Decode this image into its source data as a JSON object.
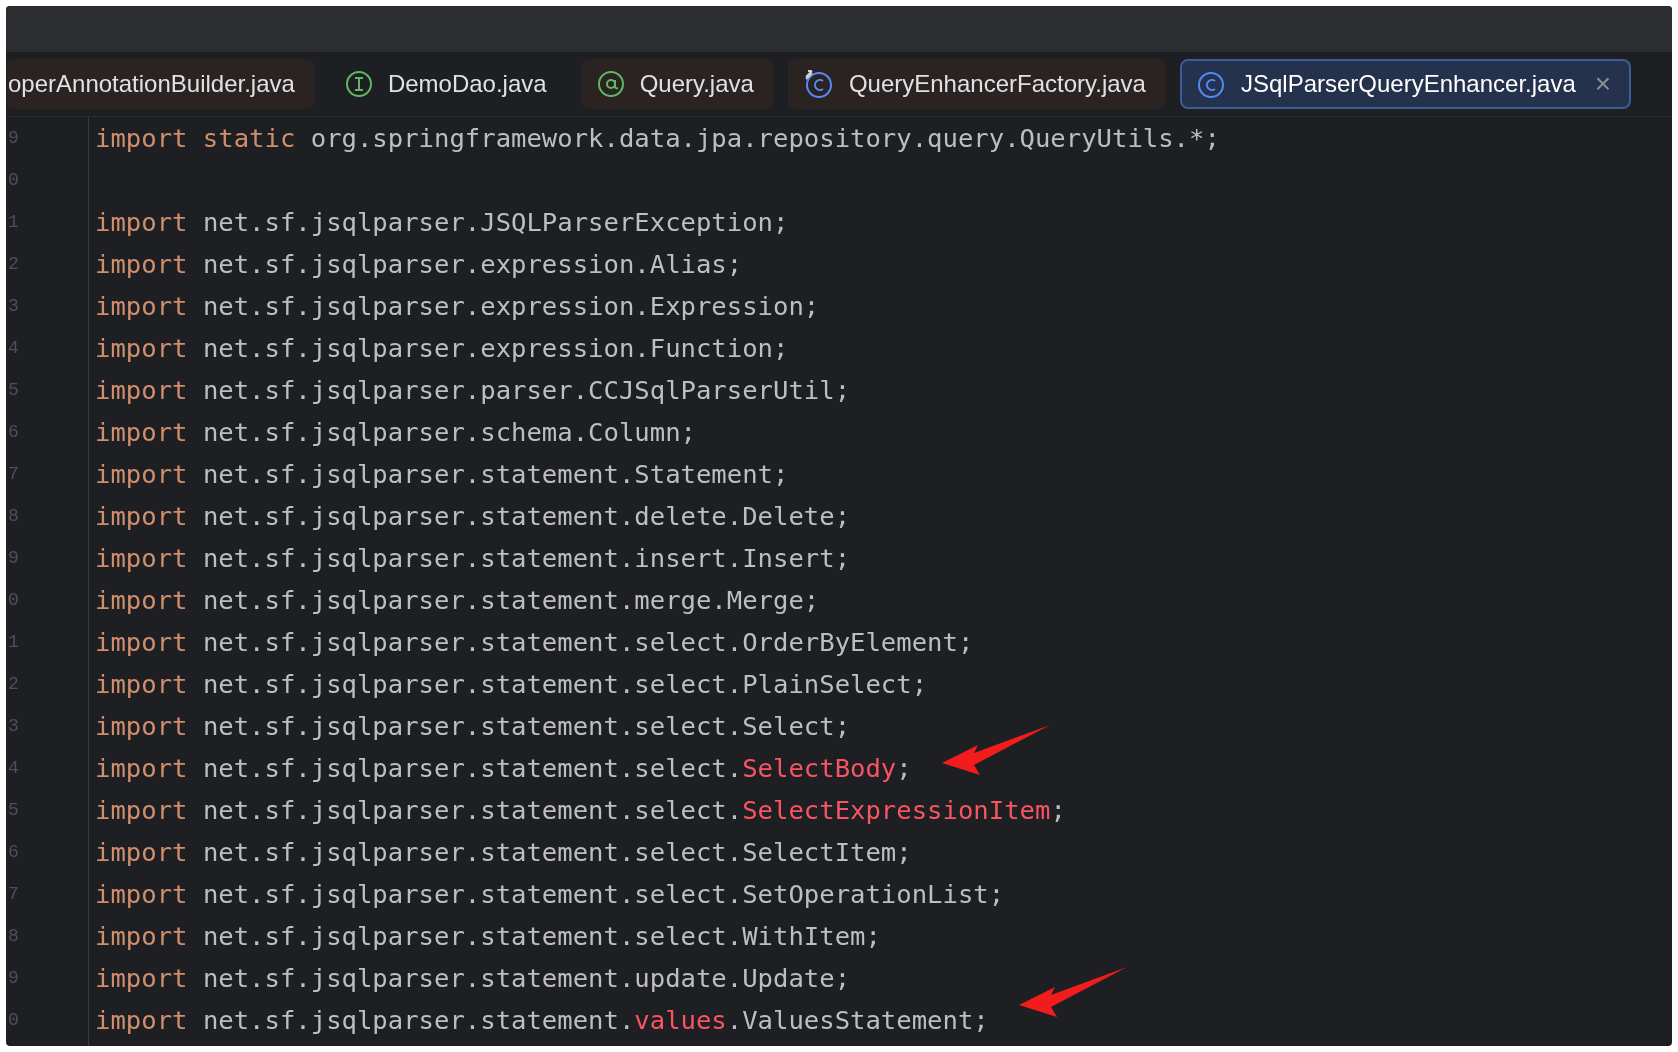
{
  "tabs": [
    {
      "label": "operAnnotationBuilder.java",
      "kind": "none",
      "selected": false,
      "color": "#2b2322"
    },
    {
      "label": "DemoDao.java",
      "kind": "interface",
      "selected": false
    },
    {
      "label": "Query.java",
      "kind": "annotation",
      "selected": false,
      "color": "#2b2322"
    },
    {
      "label": "QueryEnhancerFactory.java",
      "kind": "class-linked",
      "selected": false,
      "color": "#2b2322"
    },
    {
      "label": "JSqlParserQueryEnhancer.java",
      "kind": "class",
      "selected": true,
      "close": "×"
    }
  ],
  "editor": {
    "lines": [
      {
        "number": "9",
        "segments": [
          {
            "text": "import static ",
            "kind": "keyword"
          },
          {
            "text": "org.springframework.data.jpa.repository.query.QueryUtils.*;",
            "kind": "plain"
          }
        ]
      },
      {
        "number": "0"
      },
      {
        "number": "1",
        "segments": [
          {
            "text": "import ",
            "kind": "keyword"
          },
          {
            "text": "net.sf.jsqlparser.JSQLParserException;",
            "kind": "plain"
          }
        ]
      },
      {
        "number": "2",
        "segments": [
          {
            "text": "import ",
            "kind": "keyword"
          },
          {
            "text": "net.sf.jsqlparser.expression.Alias;",
            "kind": "plain"
          }
        ]
      },
      {
        "number": "3",
        "segments": [
          {
            "text": "import ",
            "kind": "keyword"
          },
          {
            "text": "net.sf.jsqlparser.expression.Expression;",
            "kind": "plain"
          }
        ]
      },
      {
        "number": "4",
        "segments": [
          {
            "text": "import ",
            "kind": "keyword"
          },
          {
            "text": "net.sf.jsqlparser.expression.Function;",
            "kind": "plain"
          }
        ]
      },
      {
        "number": "5",
        "segments": [
          {
            "text": "import ",
            "kind": "keyword"
          },
          {
            "text": "net.sf.jsqlparser.parser.CCJSqlParserUtil;",
            "kind": "plain"
          }
        ]
      },
      {
        "number": "6",
        "segments": [
          {
            "text": "import ",
            "kind": "keyword"
          },
          {
            "text": "net.sf.jsqlparser.schema.Column;",
            "kind": "plain"
          }
        ]
      },
      {
        "number": "7",
        "segments": [
          {
            "text": "import ",
            "kind": "keyword"
          },
          {
            "text": "net.sf.jsqlparser.statement.Statement;",
            "kind": "plain"
          }
        ]
      },
      {
        "number": "8",
        "segments": [
          {
            "text": "import ",
            "kind": "keyword"
          },
          {
            "text": "net.sf.jsqlparser.statement.delete.Delete;",
            "kind": "plain"
          }
        ]
      },
      {
        "number": "9",
        "segments": [
          {
            "text": "import ",
            "kind": "keyword"
          },
          {
            "text": "net.sf.jsqlparser.statement.insert.Insert;",
            "kind": "plain"
          }
        ]
      },
      {
        "number": "0",
        "segments": [
          {
            "text": "import ",
            "kind": "keyword"
          },
          {
            "text": "net.sf.jsqlparser.statement.merge.Merge;",
            "kind": "plain"
          }
        ]
      },
      {
        "number": "1",
        "segments": [
          {
            "text": "import ",
            "kind": "keyword"
          },
          {
            "text": "net.sf.jsqlparser.statement.select.OrderByElement;",
            "kind": "plain"
          }
        ]
      },
      {
        "number": "2",
        "segments": [
          {
            "text": "import ",
            "kind": "keyword"
          },
          {
            "text": "net.sf.jsqlparser.statement.select.PlainSelect;",
            "kind": "plain"
          }
        ]
      },
      {
        "number": "3",
        "segments": [
          {
            "text": "import ",
            "kind": "keyword"
          },
          {
            "text": "net.sf.jsqlparser.statement.select.Select;",
            "kind": "plain"
          }
        ]
      },
      {
        "number": "4",
        "segments": [
          {
            "text": "import ",
            "kind": "keyword"
          },
          {
            "text": "net.sf.jsqlparser.statement.select.",
            "kind": "plain"
          },
          {
            "text": "SelectBody",
            "kind": "error"
          },
          {
            "text": ";",
            "kind": "plain"
          }
        ],
        "arrow": true
      },
      {
        "number": "5",
        "segments": [
          {
            "text": "import ",
            "kind": "keyword"
          },
          {
            "text": "net.sf.jsqlparser.statement.select.",
            "kind": "plain"
          },
          {
            "text": "SelectExpressionItem",
            "kind": "error"
          },
          {
            "text": ";",
            "kind": "plain"
          }
        ]
      },
      {
        "number": "6",
        "segments": [
          {
            "text": "import ",
            "kind": "keyword"
          },
          {
            "text": "net.sf.jsqlparser.statement.select.SelectItem;",
            "kind": "plain"
          }
        ]
      },
      {
        "number": "7",
        "segments": [
          {
            "text": "import ",
            "kind": "keyword"
          },
          {
            "text": "net.sf.jsqlparser.statement.select.SetOperationList;",
            "kind": "plain"
          }
        ]
      },
      {
        "number": "8",
        "segments": [
          {
            "text": "import ",
            "kind": "keyword"
          },
          {
            "text": "net.sf.jsqlparser.statement.select.WithItem;",
            "kind": "plain"
          }
        ]
      },
      {
        "number": "9",
        "segments": [
          {
            "text": "import ",
            "kind": "keyword"
          },
          {
            "text": "net.sf.jsqlparser.statement.update.Update;",
            "kind": "plain"
          }
        ]
      },
      {
        "number": "0",
        "segments": [
          {
            "text": "import ",
            "kind": "keyword"
          },
          {
            "text": "net.sf.jsqlparser.statement.",
            "kind": "plain"
          },
          {
            "text": "values",
            "kind": "error"
          },
          {
            "text": ".ValuesStatement;",
            "kind": "plain"
          }
        ],
        "arrow": true
      }
    ]
  }
}
